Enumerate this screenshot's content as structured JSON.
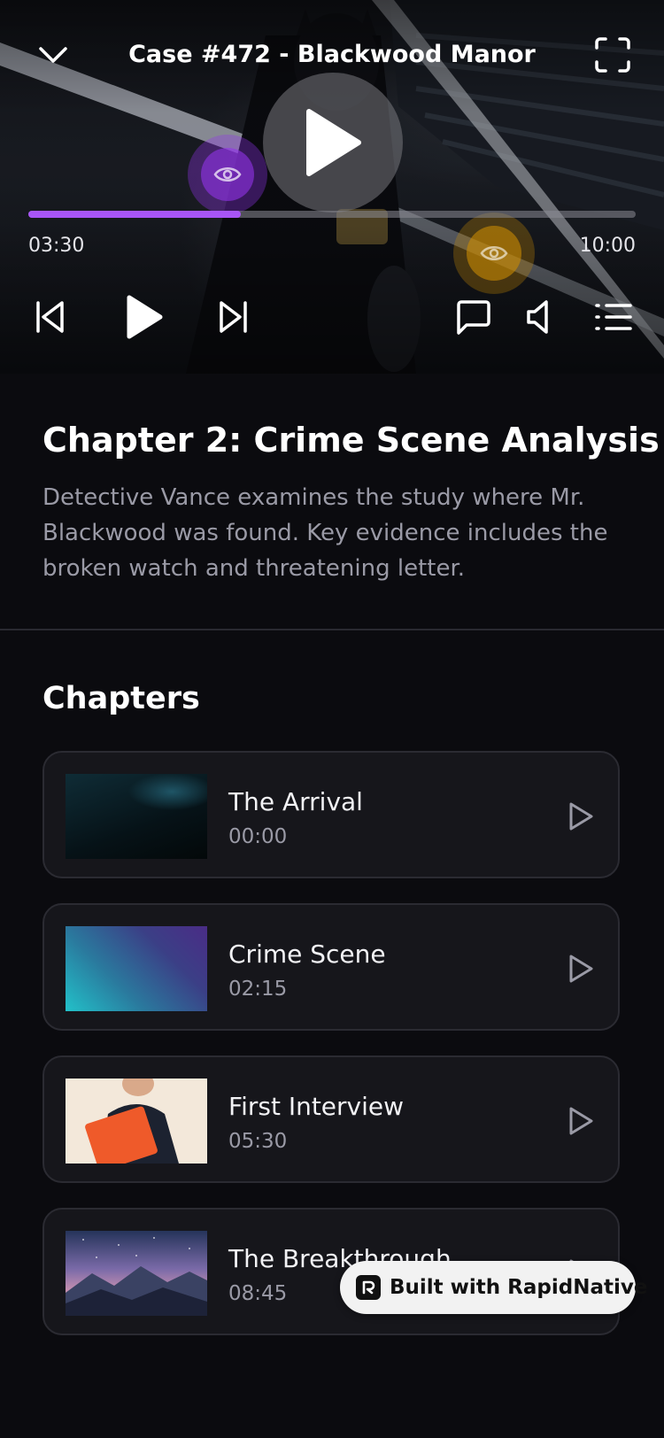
{
  "player": {
    "title": "Case #472 - Blackwood Manor",
    "current_time": "03:30",
    "duration": "10:00",
    "progress": 0.35,
    "accent_color": "#a855f7",
    "icons": {
      "collapse": "chevron-down-icon",
      "fullscreen": "fullscreen-icon",
      "big_play": "play-icon",
      "previous": "skip-back-icon",
      "play": "play-icon",
      "next": "skip-forward-icon",
      "comments": "comment-icon",
      "volume": "volume-icon",
      "playlist": "list-icon"
    },
    "evidence_markers": [
      {
        "color": "#9333ea",
        "icon": "eye-icon"
      },
      {
        "color": "#ca8a04",
        "icon": "eye-icon"
      }
    ]
  },
  "chapter": {
    "heading": "Chapter 2: Crime Scene Analysis",
    "description": "Detective Vance examines the study where Mr. Blackwood was found. Key evidence includes the broken watch and threatening letter."
  },
  "chapters_section": {
    "title": "Chapters",
    "items": [
      {
        "title": "The Arrival",
        "time": "00:00",
        "thumbnail": "dark-ocean-thumbnail"
      },
      {
        "title": "Crime Scene",
        "time": "02:15",
        "thumbnail": "teal-purple-gradient-thumbnail"
      },
      {
        "title": "First Interview",
        "time": "05:30",
        "thumbnail": "person-orange-folder-thumbnail"
      },
      {
        "title": "The Breakthrough",
        "time": "08:45",
        "thumbnail": "mountain-night-sky-thumbnail"
      }
    ]
  },
  "badge": {
    "label": "Built with RapidNative"
  }
}
